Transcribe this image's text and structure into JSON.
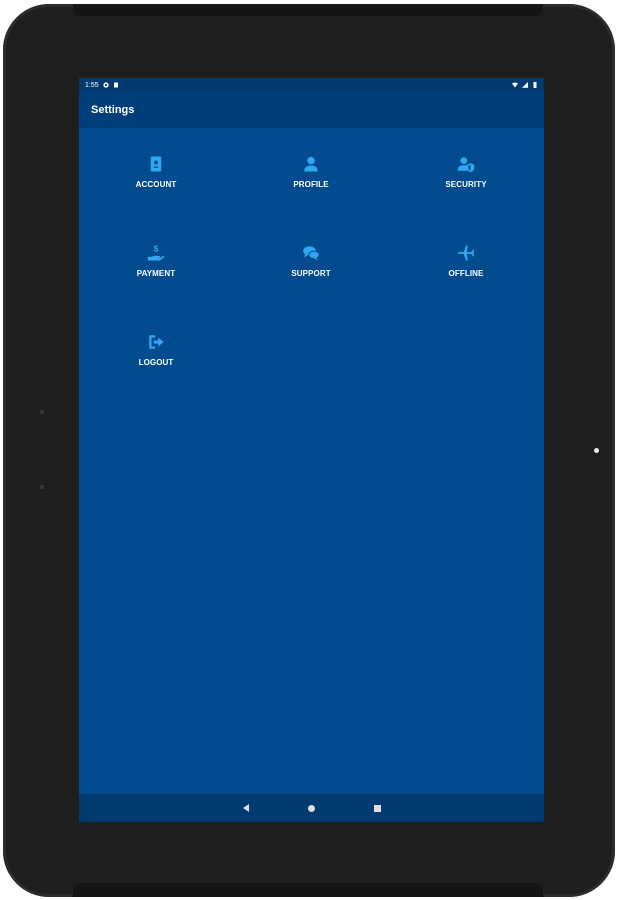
{
  "status_bar": {
    "time": "1:55",
    "left_icons": [
      "circle-status-icon",
      "sd-card-icon"
    ],
    "right_icons": [
      "wifi-icon",
      "signal-icon",
      "battery-icon"
    ]
  },
  "app_bar": {
    "title": "Settings"
  },
  "menu": [
    {
      "label": "ACCOUNT",
      "icon": "account-card-icon"
    },
    {
      "label": "PROFILE",
      "icon": "person-icon"
    },
    {
      "label": "SECURITY",
      "icon": "user-shield-icon"
    },
    {
      "label": "PAYMENT",
      "icon": "hand-dollar-icon"
    },
    {
      "label": "SUPPORT",
      "icon": "chat-bubbles-icon"
    },
    {
      "label": "OFFLINE",
      "icon": "airplane-icon"
    },
    {
      "label": "LOGOUT",
      "icon": "sign-out-icon"
    }
  ],
  "navigation": [
    "back-icon",
    "home-icon",
    "recents-icon"
  ],
  "colors": {
    "screen_background": "#024b8e",
    "app_bar": "#003f7b",
    "icon_accent": "#2fa8f2",
    "device_frame": "#1e1e1e"
  }
}
